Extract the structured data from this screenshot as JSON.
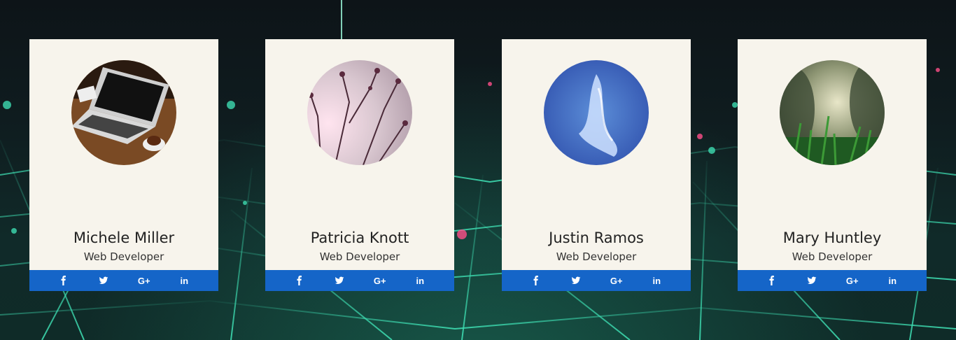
{
  "theme": {
    "card_bg": "#f7f4ec",
    "social_bar": "#1565c8",
    "grid_color": "#3ddbb0"
  },
  "cards": [
    {
      "name": "Michele Miller",
      "role": "Web Developer",
      "avatar": "laptop-coffee-photo",
      "social": [
        "facebook-icon",
        "twitter-icon",
        "google-plus-icon",
        "linkedin-icon"
      ]
    },
    {
      "name": "Patricia Knott",
      "role": "Web Developer",
      "avatar": "blossom-branches-photo",
      "social": [
        "facebook-icon",
        "twitter-icon",
        "google-plus-icon",
        "linkedin-icon"
      ]
    },
    {
      "name": "Justin Ramos",
      "role": "Web Developer",
      "avatar": "blue-sky-cloud-photo",
      "social": [
        "facebook-icon",
        "twitter-icon",
        "google-plus-icon",
        "linkedin-icon"
      ]
    },
    {
      "name": "Mary Huntley",
      "role": "Web Developer",
      "avatar": "grass-forest-photo",
      "social": [
        "facebook-icon",
        "twitter-icon",
        "google-plus-icon",
        "linkedin-icon"
      ]
    }
  ],
  "social_glyphs": {
    "google_plus": "G+",
    "linkedin": "in"
  }
}
